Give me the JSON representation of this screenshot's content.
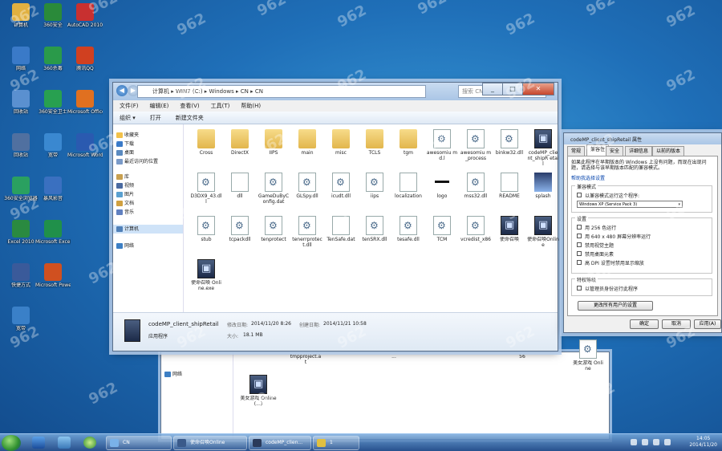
{
  "desktop": {
    "icons": [
      {
        "label": "计算机"
      },
      {
        "label": "360安全"
      },
      {
        "label": "AutoCAD 2010 - S..."
      },
      {
        "label": "网络"
      },
      {
        "label": "360杀毒"
      },
      {
        "label": "腾讯QQ"
      },
      {
        "label": "回收站"
      },
      {
        "label": "360安全卫士"
      },
      {
        "label": "Microsoft Office..."
      },
      {
        "label": "回收站"
      },
      {
        "label": "宽带"
      },
      {
        "label": "Microsoft Word 2010"
      },
      {
        "label": "360安全浏览器"
      },
      {
        "label": "暴风影音"
      },
      {
        "label": "Excel 2010"
      },
      {
        "label": "Microsoft Excel 2010"
      },
      {
        "label": "快捷方式"
      },
      {
        "label": "Microsoft PowerPoint"
      },
      {
        "label": "宽带"
      }
    ],
    "watermark": "962"
  },
  "explorer_back": {
    "items": [
      {
        "label": "tmpproject.at"
      },
      {
        "label": "..."
      },
      {
        "label": "56"
      },
      {
        "label": "美女游戏 Online"
      }
    ],
    "nav_net": "网络",
    "selected_label": "美女游戏 Online(...)"
  },
  "explorer": {
    "address": "计算机 ▸ WIN7 (C:) ▸ Windows ▸ CN ▸ CN",
    "search_placeholder": "搜索 CN",
    "menu": [
      "文件(F)",
      "编辑(E)",
      "查看(V)",
      "工具(T)",
      "帮助(H)"
    ],
    "toolbar": [
      "组织 ▾",
      "打开",
      "新建文件夹"
    ],
    "nav": [
      {
        "label": "收藏夹"
      },
      {
        "label": "下载"
      },
      {
        "label": "桌面"
      },
      {
        "label": "最近访问的位置"
      },
      {
        "label": "库"
      },
      {
        "label": "视频"
      },
      {
        "label": "图片"
      },
      {
        "label": "文档"
      },
      {
        "label": "音乐"
      },
      {
        "label": "计算机"
      },
      {
        "label": "网络"
      }
    ],
    "files": [
      {
        "label": "Cross",
        "type": "folder"
      },
      {
        "label": "DirectX",
        "type": "folder"
      },
      {
        "label": "IIPS",
        "type": "folder"
      },
      {
        "label": "main",
        "type": "folder"
      },
      {
        "label": "misc",
        "type": "folder"
      },
      {
        "label": "TCLS",
        "type": "folder"
      },
      {
        "label": "tgm",
        "type": "folder"
      },
      {
        "label": "awesomiu md.l",
        "type": "gear"
      },
      {
        "label": "awesomiu m_process",
        "type": "gear"
      },
      {
        "label": "binkw32.dll",
        "type": "gear"
      },
      {
        "label": "codeMP_client_shipR etail",
        "type": "exe"
      },
      {
        "label": "D3DX9_43.dll",
        "type": "gear"
      },
      {
        "label": "dll",
        "type": "doc"
      },
      {
        "label": "GameDuByConfig.dat",
        "type": "gear"
      },
      {
        "label": "GLSpy.dll",
        "type": "gear"
      },
      {
        "label": "icudt.dll",
        "type": "gear"
      },
      {
        "label": "iips",
        "type": "gear"
      },
      {
        "label": "localization",
        "type": "doc"
      },
      {
        "label": "logo",
        "type": "blackbar"
      },
      {
        "label": "mss32.dll",
        "type": "gear"
      },
      {
        "label": "README",
        "type": "doc"
      },
      {
        "label": "splash",
        "type": "img"
      },
      {
        "label": "stub",
        "type": "gear"
      },
      {
        "label": "tcpackdll",
        "type": "gear"
      },
      {
        "label": "tenprotect",
        "type": "gear"
      },
      {
        "label": "tenerrprotect.dll",
        "type": "gear"
      },
      {
        "label": "TenSafe.dat",
        "type": "doc"
      },
      {
        "label": "tenSRX.dll",
        "type": "gear"
      },
      {
        "label": "tesafe.dll",
        "type": "gear"
      },
      {
        "label": "TCM",
        "type": "gear"
      },
      {
        "label": "vcredist_x86",
        "type": "gear"
      },
      {
        "label": "使命召唤",
        "type": "exe"
      },
      {
        "label": "使命召唤Online",
        "type": "exe"
      },
      {
        "label": "使命召唤 Online.exe",
        "type": "exe"
      }
    ],
    "details": {
      "name": "codeMP_client_shipRetail",
      "modified_label": "修改日期:",
      "modified": "2014/11/20 8:26",
      "created_label": "创建日期:",
      "created": "2014/11/21 10:58",
      "type": "应用程序",
      "size_label": "大小:",
      "size": "18.1 MB"
    }
  },
  "properties": {
    "title": "codeMP_client_shipRetail 属性",
    "tabs": [
      "常规",
      "兼容性",
      "安全",
      "详细信息",
      "以前的版本"
    ],
    "intro": "如果此程序在早期版本的 Windows 上没有问题，而现在出现问题，请选择与该早期版本匹配的兼容模式。",
    "link": "帮助我选择设置",
    "compat_group": "兼容模式",
    "compat_check": "以兼容模式运行这个程序:",
    "compat_value": "Windows XP (Service Pack 3)",
    "settings_group": "设置",
    "settings": [
      "用 256 色运行",
      "用 640 x 480 屏幕分辨率运行",
      "禁用视觉主题",
      "禁用桌面元素",
      "高 DPI 设置时禁用显示缩放"
    ],
    "priv_group": "特权等级",
    "priv_check": "以管理员身份运行此程序",
    "all_users_btn": "更改所有用户的设置",
    "ok": "确定",
    "cancel": "取消",
    "apply": "应用(A)"
  },
  "taskbar": {
    "buttons": [
      {
        "label": "CN"
      },
      {
        "label": "使命召唤Online"
      },
      {
        "label": "codeMP_clien..."
      },
      {
        "label": "1"
      }
    ],
    "time": "14:05",
    "date": "2014/11/20"
  }
}
